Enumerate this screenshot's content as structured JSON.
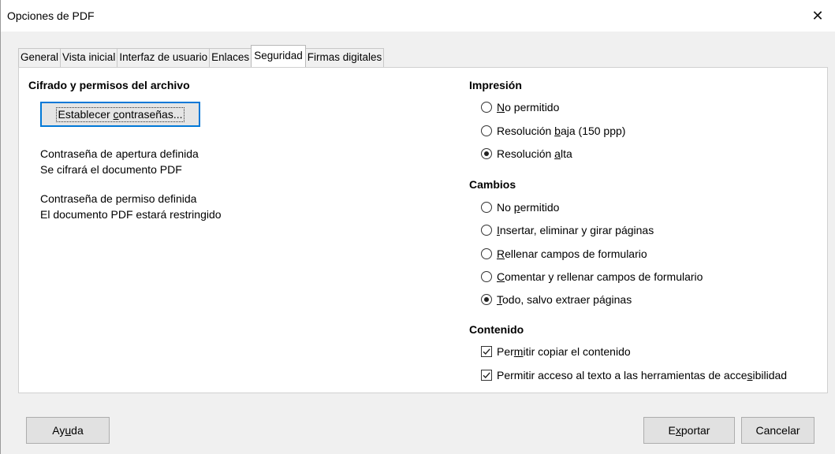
{
  "window": {
    "title": "Opciones de PDF",
    "close_glyph": "✕"
  },
  "tabs": [
    {
      "label": "General"
    },
    {
      "label": "Vista inicial"
    },
    {
      "label": "Interfaz de usuario"
    },
    {
      "label": "Enlaces"
    },
    {
      "label": "Seguridad",
      "active": true
    },
    {
      "label": "Firmas digitales"
    }
  ],
  "encryption": {
    "heading": "Cifrado y permisos del archivo",
    "button": {
      "pre": "Establecer ",
      "ul": "c",
      "post": "ontraseñas..."
    },
    "open_pwd_line1": "Contraseña de apertura definida",
    "open_pwd_line2": "Se cifrará el documento PDF",
    "perm_pwd_line1": "Contraseña de permiso definida",
    "perm_pwd_line2": "El documento PDF estará restringido"
  },
  "printing": {
    "heading": "Impresión",
    "options": [
      {
        "pre": "",
        "ul": "N",
        "post": "o permitido",
        "checked": false
      },
      {
        "pre": "Resolución ",
        "ul": "b",
        "post": "aja (150 ppp)",
        "checked": false
      },
      {
        "pre": "Resolución ",
        "ul": "a",
        "post": "lta",
        "checked": true
      }
    ]
  },
  "changes": {
    "heading": "Cambios",
    "options": [
      {
        "pre": "No ",
        "ul": "p",
        "post": "ermitido",
        "checked": false
      },
      {
        "pre": "",
        "ul": "I",
        "post": "nsertar, eliminar y girar páginas",
        "checked": false
      },
      {
        "pre": "",
        "ul": "R",
        "post": "ellenar campos de formulario",
        "checked": false
      },
      {
        "pre": "",
        "ul": "C",
        "post": "omentar y rellenar campos de formulario",
        "checked": false
      },
      {
        "pre": "",
        "ul": "T",
        "post": "odo, salvo extraer páginas",
        "checked": true
      }
    ]
  },
  "content": {
    "heading": "Contenido",
    "options": [
      {
        "pre": "Per",
        "ul": "m",
        "post": "itir copiar el contenido",
        "checked": true
      },
      {
        "pre": "Permitir acceso al texto a las herramientas de acce",
        "ul": "s",
        "post": "ibilidad",
        "checked": true
      }
    ]
  },
  "footer": {
    "help": {
      "pre": "Ay",
      "ul": "u",
      "post": "da"
    },
    "export": {
      "pre": "E",
      "ul": "x",
      "post": "portar"
    },
    "cancel": "Cancelar"
  }
}
